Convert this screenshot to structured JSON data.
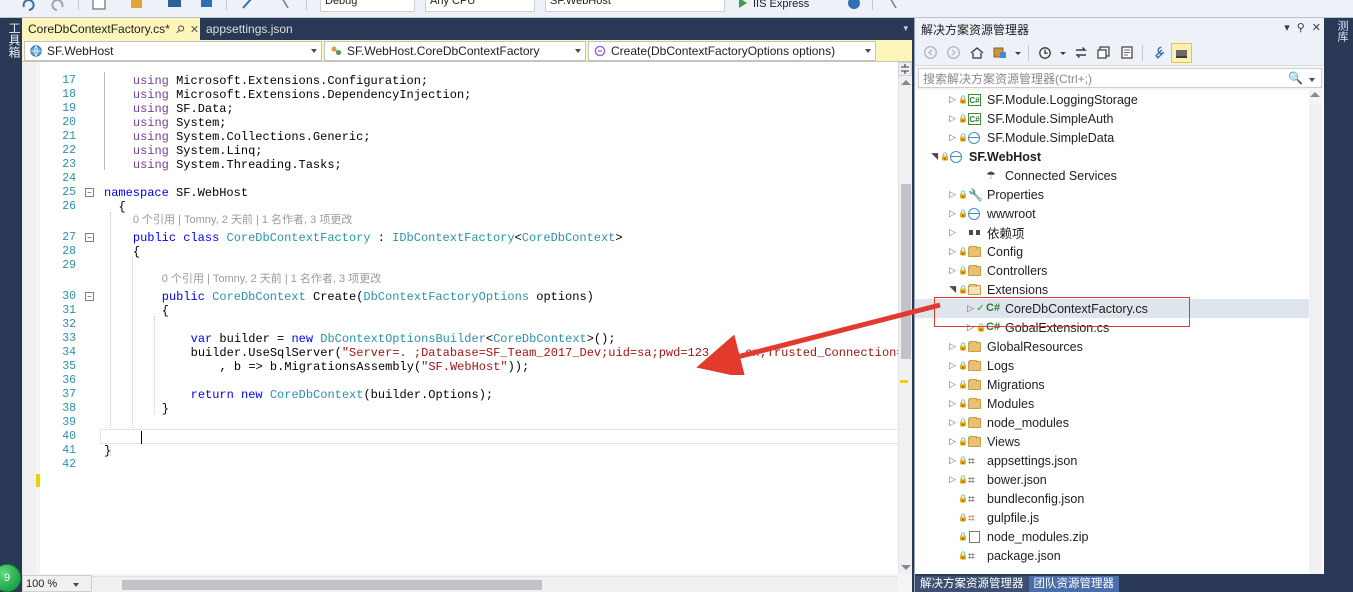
{
  "window": {
    "left_rail_label": "工具箱",
    "right_rail_label": "测库",
    "badge_text": "9"
  },
  "toolbar": {
    "config_combo": "Debug",
    "platform_combo": "Any CPU",
    "startup_combo": "SF.WebHost",
    "run_label": "IIS Express"
  },
  "tabs": [
    {
      "label": "CoreDbContextFactory.cs*",
      "active": true,
      "pin_icon": "pin-icon",
      "close_icon": "close-icon"
    },
    {
      "label": "appsettings.json",
      "active": false
    }
  ],
  "navbar": {
    "project_combo": "SF.WebHost",
    "type_combo": "SF.WebHost.CoreDbContextFactory",
    "member_combo": "Create(DbContextFactoryOptions options)"
  },
  "editor": {
    "zoom_level": "100 %",
    "codelens_text": "0 个引用 | Tomny, 2 天前 | 1 名作者, 3 项更改",
    "lines": [
      {
        "num": "17",
        "indent": 4,
        "segments": [
          {
            "t": "using ",
            "c": "kw2"
          },
          {
            "t": "Microsoft.Extensions.Configuration;",
            "c": "plain"
          }
        ]
      },
      {
        "num": "18",
        "indent": 4,
        "segments": [
          {
            "t": "using ",
            "c": "kw2"
          },
          {
            "t": "Microsoft.Extensions.DependencyInjection;",
            "c": "plain"
          }
        ]
      },
      {
        "num": "19",
        "indent": 4,
        "segments": [
          {
            "t": "using ",
            "c": "kw2"
          },
          {
            "t": "SF.Data;",
            "c": "plain"
          }
        ]
      },
      {
        "num": "20",
        "indent": 4,
        "segments": [
          {
            "t": "using ",
            "c": "kw2"
          },
          {
            "t": "System;",
            "c": "plain"
          }
        ]
      },
      {
        "num": "21",
        "indent": 4,
        "segments": [
          {
            "t": "using ",
            "c": "kw2"
          },
          {
            "t": "System.Collections.Generic;",
            "c": "plain"
          }
        ]
      },
      {
        "num": "22",
        "indent": 4,
        "segments": [
          {
            "t": "using ",
            "c": "kw2"
          },
          {
            "t": "System.Linq;",
            "c": "plain"
          }
        ]
      },
      {
        "num": "23",
        "indent": 4,
        "segments": [
          {
            "t": "using ",
            "c": "kw2"
          },
          {
            "t": "System.Threading.Tasks;",
            "c": "plain"
          }
        ]
      },
      {
        "num": "24",
        "indent": 0,
        "segments": []
      },
      {
        "num": "25",
        "indent": 0,
        "segments": [
          {
            "t": "namespace ",
            "c": "kw"
          },
          {
            "t": "SF.WebHost",
            "c": "plain"
          }
        ]
      },
      {
        "num": "26",
        "indent": 2,
        "segments": [
          {
            "t": "{",
            "c": "plain"
          }
        ]
      },
      {
        "num": "27",
        "indent": 4,
        "segments": [
          {
            "t": "public class ",
            "c": "kw"
          },
          {
            "t": "CoreDbContextFactory",
            "c": "typ"
          },
          {
            "t": " : ",
            "c": "plain"
          },
          {
            "t": "IDbContextFactory",
            "c": "typ"
          },
          {
            "t": "<",
            "c": "plain"
          },
          {
            "t": "CoreDbContext",
            "c": "typ"
          },
          {
            "t": ">",
            "c": "plain"
          }
        ]
      },
      {
        "num": "28",
        "indent": 4,
        "segments": [
          {
            "t": "{",
            "c": "plain"
          }
        ]
      },
      {
        "num": "29",
        "indent": 0,
        "segments": []
      },
      {
        "num": "30",
        "indent": 8,
        "segments": [
          {
            "t": "public ",
            "c": "kw"
          },
          {
            "t": "CoreDbContext",
            "c": "typ"
          },
          {
            "t": " Create(",
            "c": "plain"
          },
          {
            "t": "DbContextFactoryOptions",
            "c": "typ"
          },
          {
            "t": " options)",
            "c": "plain"
          }
        ]
      },
      {
        "num": "31",
        "indent": 8,
        "segments": [
          {
            "t": "{",
            "c": "plain"
          }
        ]
      },
      {
        "num": "32",
        "indent": 0,
        "segments": []
      },
      {
        "num": "33",
        "indent": 12,
        "segments": [
          {
            "t": "var",
            "c": "kw"
          },
          {
            "t": " builder = ",
            "c": "plain"
          },
          {
            "t": "new",
            "c": "kw"
          },
          {
            "t": " ",
            "c": "plain"
          },
          {
            "t": "DbContextOptionsBuilder",
            "c": "typ"
          },
          {
            "t": "<",
            "c": "plain"
          },
          {
            "t": "CoreDbContext",
            "c": "typ"
          },
          {
            "t": ">();",
            "c": "plain"
          }
        ]
      },
      {
        "num": "34",
        "indent": 12,
        "segments": [
          {
            "t": "builder.UseSqlServer(",
            "c": "plain"
          },
          {
            "t": "\"Server=. ;Database=SF_Team_2017_Dev;uid=sa;pwd=123.com.cn;Trusted_Connection=",
            "c": "str"
          }
        ]
      },
      {
        "num": "35",
        "indent": 16,
        "segments": [
          {
            "t": ", b => b.MigrationsAssembly(",
            "c": "plain"
          },
          {
            "t": "\"SF.WebHost\"",
            "c": "str"
          },
          {
            "t": "));",
            "c": "plain"
          }
        ]
      },
      {
        "num": "36",
        "indent": 0,
        "segments": []
      },
      {
        "num": "37",
        "indent": 12,
        "segments": [
          {
            "t": "return new",
            "c": "kw"
          },
          {
            "t": " ",
            "c": "plain"
          },
          {
            "t": "CoreDbContext",
            "c": "typ"
          },
          {
            "t": "(builder.Options);",
            "c": "plain"
          }
        ]
      },
      {
        "num": "38",
        "indent": 8,
        "segments": [
          {
            "t": "}",
            "c": "plain"
          }
        ]
      },
      {
        "num": "39",
        "indent": 0,
        "segments": []
      },
      {
        "num": "40",
        "indent": 4,
        "segments": [
          {
            "t": "}",
            "c": "plain"
          }
        ]
      },
      {
        "num": "41",
        "indent": 0,
        "segments": [
          {
            "t": "}",
            "c": "plain"
          }
        ]
      },
      {
        "num": "42",
        "indent": 0,
        "segments": []
      }
    ]
  },
  "solution_explorer": {
    "title": "解决方案资源管理器",
    "search_placeholder": "搜索解决方案资源管理器(Ctrl+;)",
    "header_buttons": [
      {
        "name": "dropdown-icon",
        "glyph": "▾"
      },
      {
        "name": "pin-icon",
        "glyph": "⚲"
      },
      {
        "name": "close-icon",
        "glyph": "✕"
      }
    ],
    "toolbar_buttons": [
      {
        "name": "back-icon",
        "glyph": "◐",
        "active": false
      },
      {
        "name": "forward-icon",
        "glyph": "◑",
        "active": false
      },
      {
        "name": "home-icon",
        "glyph": "⌂",
        "active": false
      },
      {
        "name": "sync-with-active-document-icon",
        "glyph": "⎙",
        "active": false
      },
      {
        "name": "chevron-down-icon",
        "glyph": "▾",
        "active": false
      },
      {
        "name": "pending-changes-icon",
        "glyph": "◔",
        "active": false
      },
      {
        "name": "chevron-down-icon-2",
        "glyph": "▾",
        "active": false
      },
      {
        "name": "refresh-icon",
        "glyph": "⇆",
        "active": false
      },
      {
        "name": "collapse-all-icon",
        "glyph": "❐",
        "active": false
      },
      {
        "name": "show-all-files-icon",
        "glyph": "▤",
        "active": false
      },
      {
        "name": "properties-icon",
        "glyph": "🔧",
        "active": false
      },
      {
        "name": "preview-selected-items-icon",
        "glyph": "▬",
        "active": true
      }
    ],
    "tree": [
      {
        "label": "SF.Module.LoggingStorage",
        "indent": 1,
        "expander": "collapsed",
        "icon": "csharp-project-icon",
        "lock": true
      },
      {
        "label": "SF.Module.SimpleAuth",
        "indent": 1,
        "expander": "collapsed",
        "icon": "csharp-project-icon",
        "lock": true
      },
      {
        "label": "SF.Module.SimpleData",
        "indent": 1,
        "expander": "collapsed",
        "icon": "web-project-icon",
        "lock": true
      },
      {
        "label": "SF.WebHost",
        "indent": 0,
        "expander": "expanded",
        "icon": "web-project-icon",
        "lock": true,
        "bold": true
      },
      {
        "label": "Connected Services",
        "indent": 2,
        "expander": "none",
        "icon": "connected-services-icon"
      },
      {
        "label": "Properties",
        "indent": 1,
        "expander": "collapsed",
        "icon": "properties-icon",
        "lock": true
      },
      {
        "label": "wwwroot",
        "indent": 1,
        "expander": "collapsed",
        "icon": "wwwroot-icon",
        "lock": true
      },
      {
        "label": "依赖项",
        "indent": 1,
        "expander": "collapsed",
        "icon": "dependencies-icon"
      },
      {
        "label": "Config",
        "indent": 1,
        "expander": "collapsed",
        "icon": "folder-icon",
        "lock": true
      },
      {
        "label": "Controllers",
        "indent": 1,
        "expander": "collapsed",
        "icon": "folder-icon",
        "lock": true
      },
      {
        "label": "Extensions",
        "indent": 1,
        "expander": "expanded",
        "icon": "folder-open-icon",
        "lock": true
      },
      {
        "label": "CoreDbContextFactory.cs",
        "indent": 2,
        "expander": "collapsed",
        "icon": "csharp-file-icon",
        "check": true,
        "selected": true
      },
      {
        "label": "GobalExtension.cs",
        "indent": 2,
        "expander": "collapsed",
        "icon": "csharp-file-icon",
        "lock": true
      },
      {
        "label": "GlobalResources",
        "indent": 1,
        "expander": "collapsed",
        "icon": "folder-icon",
        "lock": true
      },
      {
        "label": "Logs",
        "indent": 1,
        "expander": "collapsed",
        "icon": "folder-icon",
        "lock": true
      },
      {
        "label": "Migrations",
        "indent": 1,
        "expander": "collapsed",
        "icon": "folder-icon",
        "lock": true
      },
      {
        "label": "Modules",
        "indent": 1,
        "expander": "collapsed",
        "icon": "folder-icon",
        "lock": true
      },
      {
        "label": "node_modules",
        "indent": 1,
        "expander": "collapsed",
        "icon": "folder-icon",
        "lock": true
      },
      {
        "label": "Views",
        "indent": 1,
        "expander": "collapsed",
        "icon": "folder-icon",
        "lock": true
      },
      {
        "label": "appsettings.json",
        "indent": 1,
        "expander": "collapsed",
        "icon": "json-file-icon",
        "lock": true
      },
      {
        "label": "bower.json",
        "indent": 1,
        "expander": "collapsed",
        "icon": "json-file-icon",
        "lock": true
      },
      {
        "label": "bundleconfig.json",
        "indent": 1,
        "expander": "none",
        "icon": "json-file-icon",
        "lock": true
      },
      {
        "label": "gulpfile.js",
        "indent": 1,
        "expander": "none",
        "icon": "js-file-icon",
        "lock": true
      },
      {
        "label": "node_modules.zip",
        "indent": 1,
        "expander": "none",
        "icon": "generic-file-icon",
        "lock": true
      },
      {
        "label": "package.json",
        "indent": 1,
        "expander": "none",
        "icon": "json-file-icon",
        "lock": true
      }
    ],
    "bottom_tabs": [
      {
        "label": "解决方案资源管理器",
        "active": true
      },
      {
        "label": "团队资源管理器",
        "active": false
      }
    ]
  },
  "annotations": {
    "highlight_color": "#e33a2e",
    "arrow_color": "#e33a2e"
  }
}
